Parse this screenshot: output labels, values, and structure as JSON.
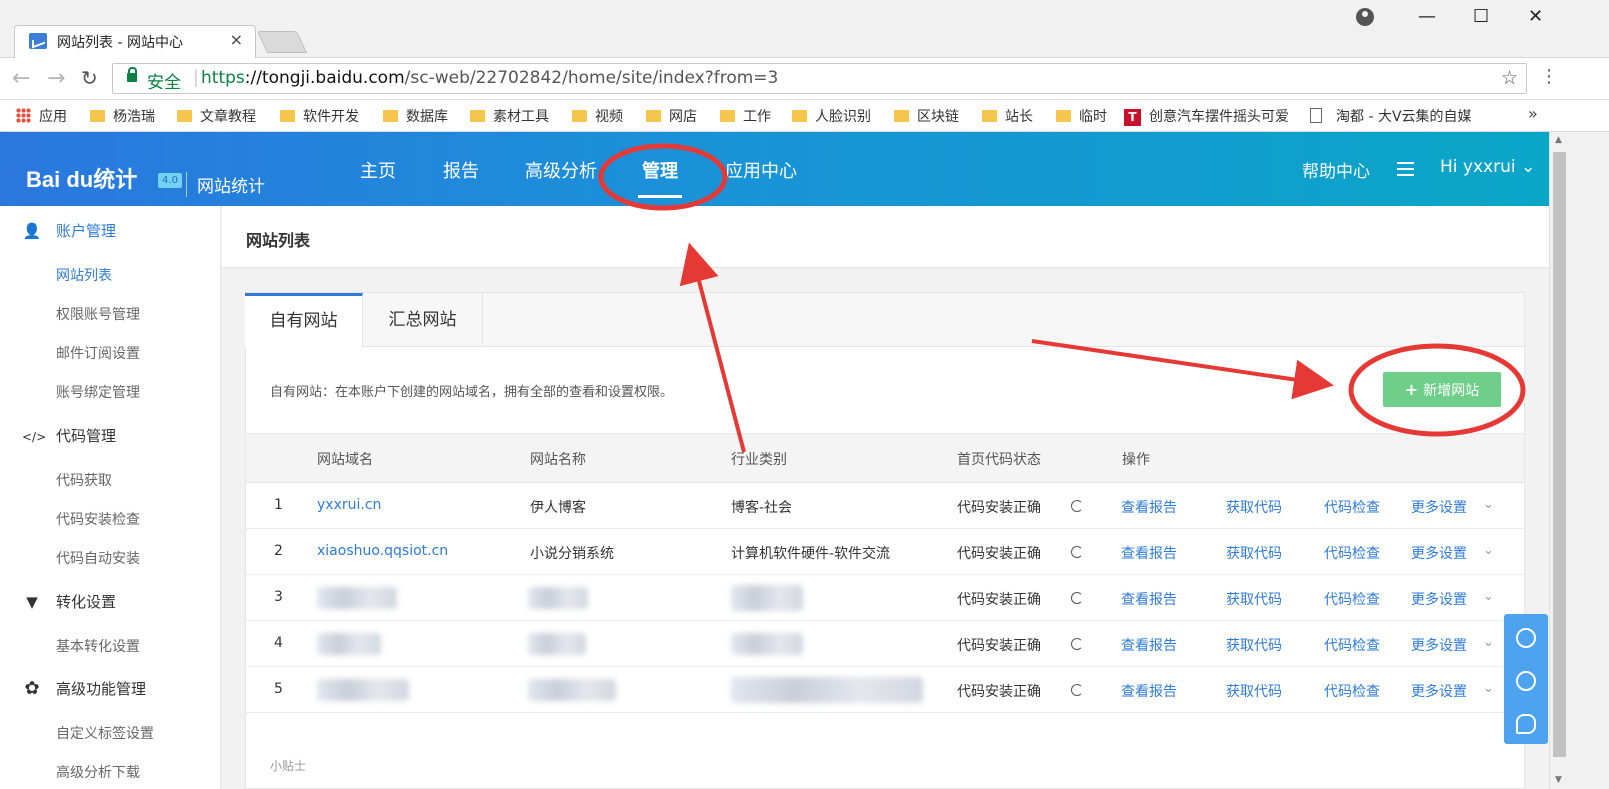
{
  "browser": {
    "tab_title": "网站列表 - 网站中心",
    "tab_close": "×",
    "secure_label": "安全",
    "url_scheme": "https",
    "url_host": "://tongji.baidu.com",
    "url_path": "/sc-web/22702842/home/site/index?from=3",
    "win_min": "—",
    "win_max": "☐",
    "win_close": "✕",
    "back": "←",
    "forward": "→",
    "reload": "↻",
    "star": "☆",
    "menu": "⋮",
    "bookmarks": [
      "应用",
      "杨浩瑞",
      "文章教程",
      "软件开发",
      "数据库",
      "素材工具",
      "视频",
      "网店",
      "工作",
      "人脸识别",
      "区块链",
      "站长",
      "临时",
      "创意汽车摆件摇头可爱",
      "淘都 - 大V云集的自媒"
    ],
    "bookmarks_more": "»"
  },
  "header": {
    "logo": "Bai du统计",
    "logo_badge": "4.0",
    "logo_sub": "网站统计",
    "nav": [
      "主页",
      "报告",
      "高级分析",
      "管理",
      "应用中心"
    ],
    "active_nav": "管理",
    "help": "帮助中心",
    "user": "Hi  yxxrui ⌄"
  },
  "sidebar": {
    "groups": [
      {
        "icon": "user-icon",
        "label": "账户管理",
        "items": [
          "网站列表",
          "权限账号管理",
          "邮件订阅设置",
          "账号绑定管理"
        ]
      },
      {
        "icon": "code-icon",
        "label": "代码管理",
        "items": [
          "代码获取",
          "代码安装检查",
          "代码自动安装"
        ]
      },
      {
        "icon": "filter-icon",
        "label": "转化设置",
        "items": [
          "基本转化设置"
        ]
      },
      {
        "icon": "puzzle-icon",
        "label": "高级功能管理",
        "items": [
          "自定义标签设置",
          "高级分析下载"
        ]
      }
    ],
    "glyphs": {
      "user": "👤",
      "code": "</>",
      "filter": "▼",
      "puzzle": "✿"
    }
  },
  "main": {
    "page_title": "网站列表",
    "tabs": [
      "自有网站",
      "汇总网站"
    ],
    "description": "自有网站：在本账户下创建的网站域名，拥有全部的查看和设置权限。",
    "add_button": "新增网站",
    "add_plus": "+",
    "columns": [
      "网站域名",
      "网站名称",
      "行业类别",
      "首页代码状态",
      "操作"
    ],
    "rows": [
      {
        "no": "1",
        "domain": "yxxrui.cn",
        "name": "伊人博客",
        "industry": "博客-社会",
        "status": "代码安装正确"
      },
      {
        "no": "2",
        "domain": "xiaoshuo.qqsiot.cn",
        "name": "小说分销系统",
        "industry": "计算机软件硬件-软件交流",
        "status": "代码安装正确"
      },
      {
        "no": "3",
        "domain": "",
        "name": "",
        "industry": "",
        "status": "代码安装正确"
      },
      {
        "no": "4",
        "domain": "",
        "name": "",
        "industry": "",
        "status": "代码安装正确"
      },
      {
        "no": "5",
        "domain": "",
        "name": "",
        "industry": "",
        "status": "代码安装正确"
      }
    ],
    "actions": [
      "查看报告",
      "获取代码",
      "代码检查",
      "更多设置"
    ],
    "chevron": "⌄",
    "footer_hint": "小贴士"
  },
  "colors": {
    "brand_blue": "#2f7bd6",
    "add_green": "#6fcf8a",
    "annotation_red": "#e53935"
  }
}
